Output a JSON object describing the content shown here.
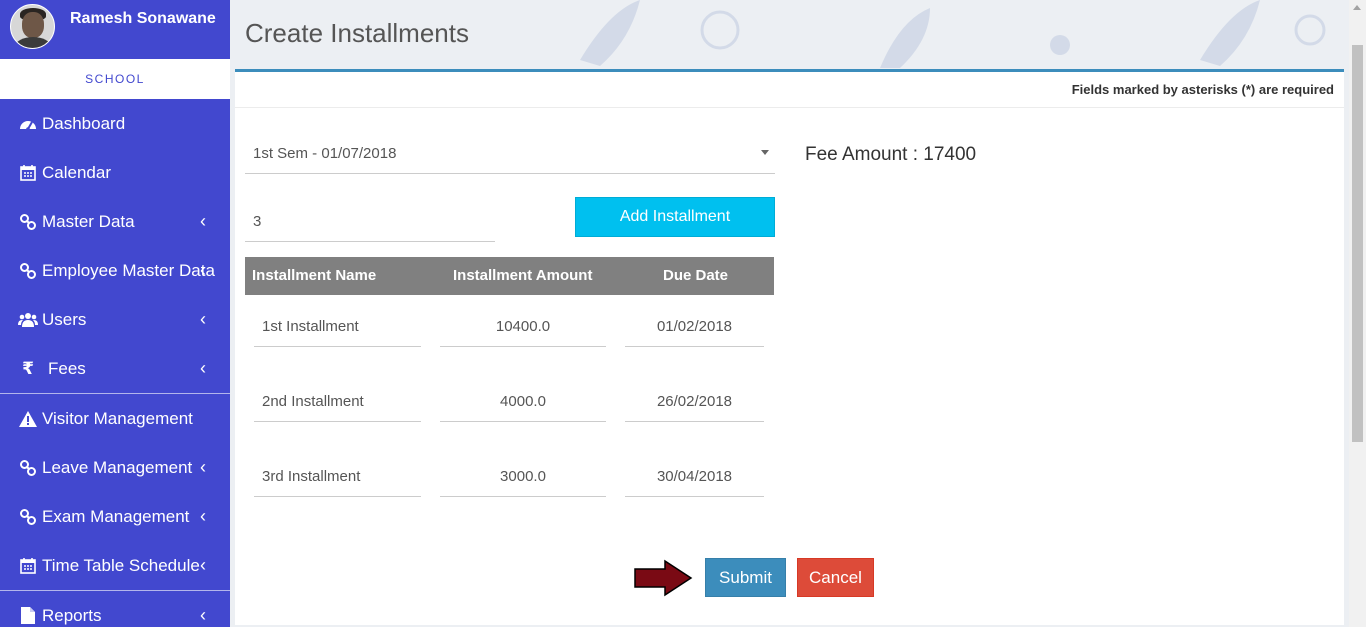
{
  "user": {
    "name": "Ramesh Sonawane",
    "role": "SCHOOL"
  },
  "sidebar": {
    "items": [
      {
        "label": "Dashboard",
        "icon": "dashboard-icon",
        "has_submenu": false
      },
      {
        "label": "Calendar",
        "icon": "calendar-icon",
        "has_submenu": false
      },
      {
        "label": "Master Data",
        "icon": "link-icon",
        "has_submenu": true
      },
      {
        "label": "Employee Master Data",
        "icon": "link-icon",
        "has_submenu": true
      },
      {
        "label": "Users",
        "icon": "users-icon",
        "has_submenu": true
      },
      {
        "label": "Fees",
        "icon": "rupee-icon",
        "has_submenu": true
      },
      {
        "label": "Visitor Management",
        "icon": "warning-icon",
        "has_submenu": false
      },
      {
        "label": "Leave Management",
        "icon": "link-icon",
        "has_submenu": true
      },
      {
        "label": "Exam Management",
        "icon": "link-icon",
        "has_submenu": true
      },
      {
        "label": "Time Table Schedule",
        "icon": "calendar-icon",
        "has_submenu": true
      },
      {
        "label": "Reports",
        "icon": "file-icon",
        "has_submenu": true
      }
    ],
    "chevron": "‹"
  },
  "page": {
    "title": "Create Installments",
    "required_note": "Fields marked by asterisks (*) are required"
  },
  "form": {
    "semester_value": "1st Sem - 01/07/2018",
    "fee_amount": "Fee Amount : 17400",
    "installment_count": "3",
    "add_button": "Add Installment",
    "columns": [
      "Installment Name",
      "Installment Amount",
      "Due Date"
    ],
    "rows": [
      {
        "name": "1st Installment",
        "amount": "10400.0",
        "due": "01/02/2018"
      },
      {
        "name": "2nd Installment",
        "amount": "4000.0",
        "due": "26/02/2018"
      },
      {
        "name": "3rd Installment",
        "amount": "3000.0",
        "due": "30/04/2018"
      }
    ],
    "submit_label": "Submit",
    "cancel_label": "Cancel"
  },
  "colors": {
    "sidebar": "#4248cf",
    "accent_info": "#00c0ef",
    "primary": "#3c8dbc",
    "danger": "#dd4b39",
    "arrow": "#7a0a14"
  }
}
